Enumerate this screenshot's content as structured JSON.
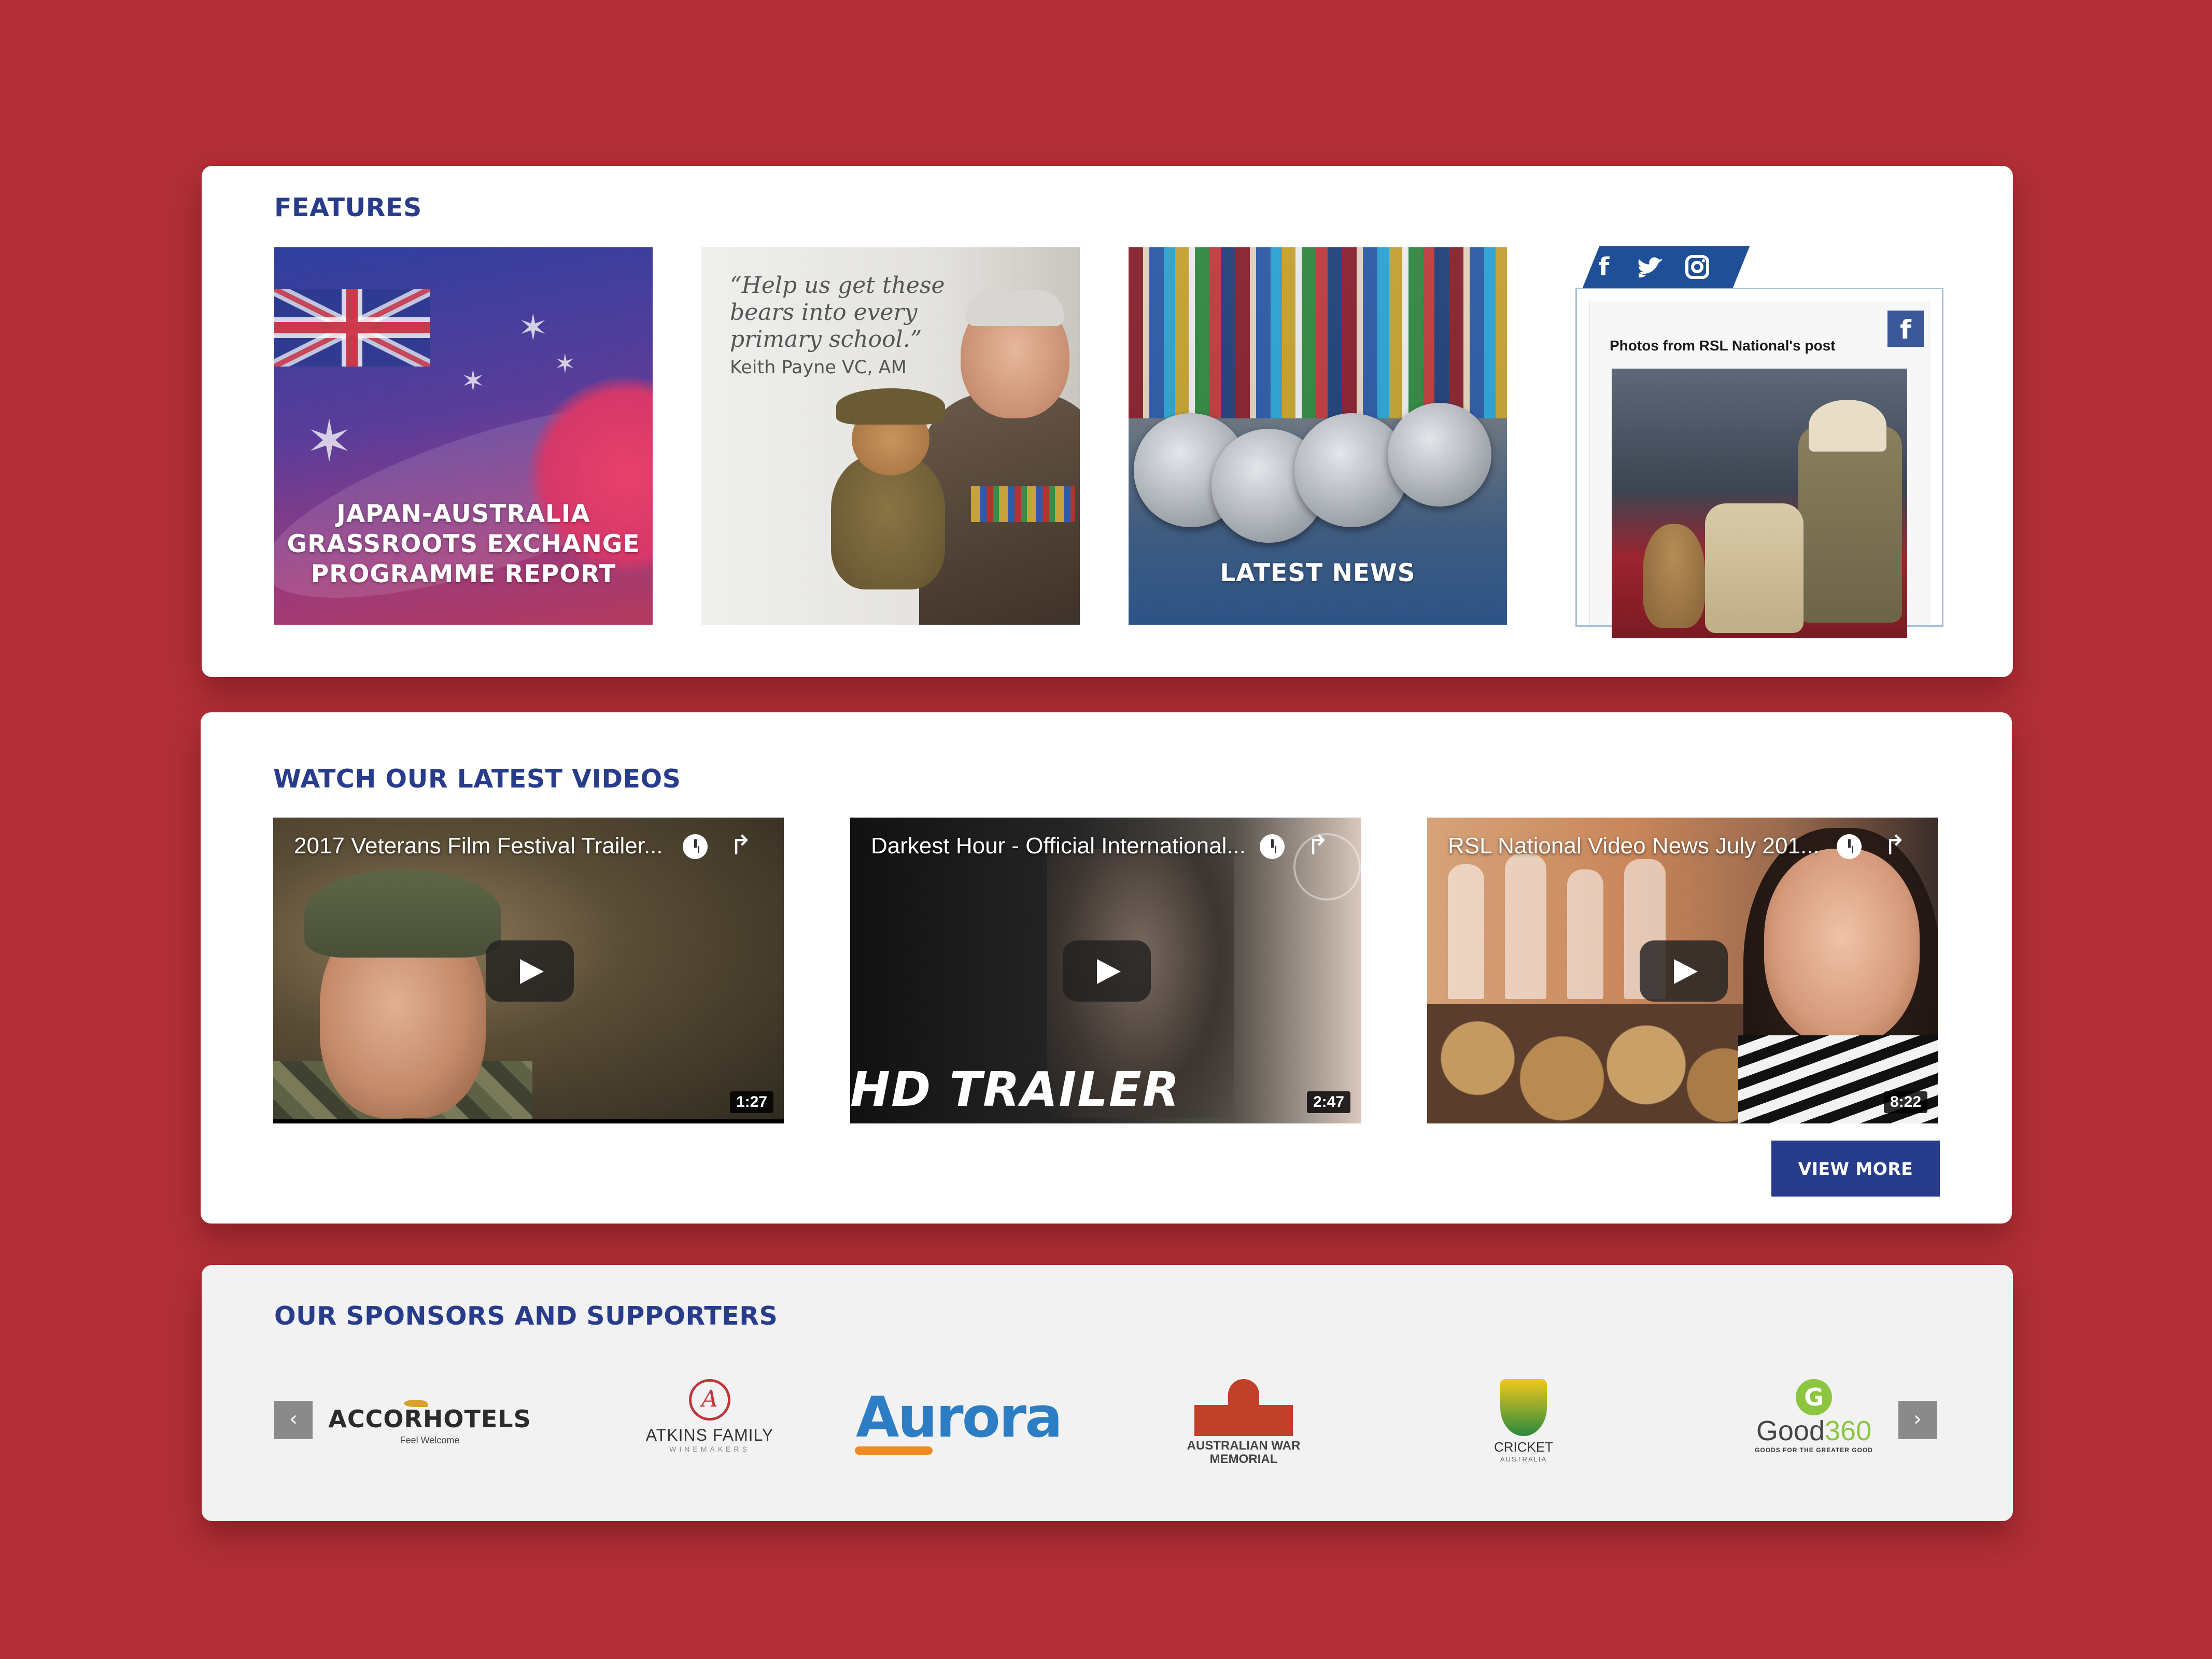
{
  "features": {
    "title": "FEATURES",
    "tiles": [
      {
        "caption": "JAPAN-AUSTRALIA GRASSROOTS EXCHANGE PROGRAMME REPORT"
      },
      {
        "quote": "“Help us get these bears into every primary school.”",
        "author": "Keith Payne VC, AM"
      },
      {
        "caption": "LATEST NEWS"
      }
    ],
    "social": {
      "tabs": [
        "f",
        "twitter",
        "instagram"
      ],
      "post_title": "Photos from RSL National's post",
      "badge": "f"
    }
  },
  "videos": {
    "title": "WATCH OUR LATEST VIDEOS",
    "items": [
      {
        "title": "2017 Veterans Film Festival Trailer...",
        "duration": "1:27"
      },
      {
        "title": "Darkest Hour - Official International...",
        "duration": "2:47",
        "overlay": "HD TRAILER"
      },
      {
        "title": "RSL National Video News July 201...",
        "duration": "8:22"
      }
    ],
    "share_icon": "↱",
    "view_more": "VIEW MORE"
  },
  "sponsors": {
    "title": "OUR SPONSORS AND SUPPORTERS",
    "prev": "‹",
    "next": "›",
    "logos": [
      {
        "name": "ACCORHOTELS",
        "tagline": "Feel Welcome"
      },
      {
        "mark": "A",
        "name": "ATKINS FAMILY",
        "tagline": "WINEMAKERS"
      },
      {
        "name": "Aurora"
      },
      {
        "name": "AUSTRALIAN WAR MEMORIAL"
      },
      {
        "name": "CRICKET",
        "tagline": "AUSTRALIA"
      },
      {
        "mark": "G",
        "name": "Good",
        "number": "360",
        "tagline": "GOODS FOR THE GREATER GOOD"
      }
    ]
  },
  "colors": {
    "background": "#b22f37",
    "heading": "#283c8c",
    "button": "#283c8c",
    "facebook": "#3b5998"
  }
}
